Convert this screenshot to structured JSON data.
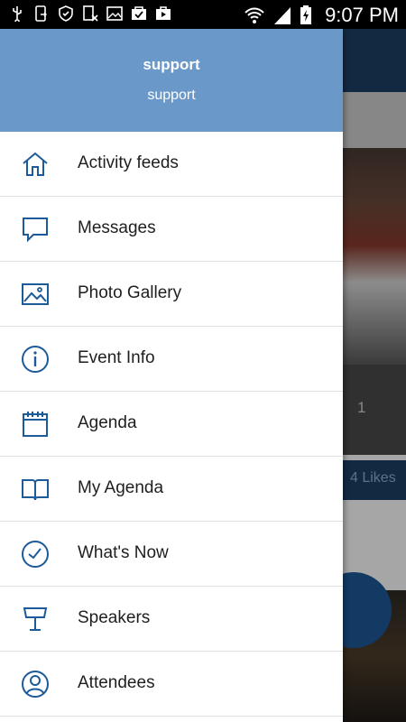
{
  "status_bar": {
    "time": "9:07 PM",
    "left_icons": [
      "usb-icon",
      "device-icon",
      "shield-icon",
      "data-blocked-icon",
      "image-icon",
      "clipboard-check-icon",
      "briefcase-play-icon"
    ],
    "right_icons": [
      "wifi-icon",
      "signal-icon",
      "battery-charging-icon"
    ]
  },
  "drawer": {
    "header": {
      "name": "support",
      "subtitle": "support"
    },
    "items": [
      {
        "label": "Activity feeds",
        "icon": "home-icon"
      },
      {
        "label": "Messages",
        "icon": "chat-icon"
      },
      {
        "label": "Photo Gallery",
        "icon": "image-icon"
      },
      {
        "label": "Event Info",
        "icon": "info-icon"
      },
      {
        "label": "Agenda",
        "icon": "calendar-icon"
      },
      {
        "label": "My Agenda",
        "icon": "book-icon"
      },
      {
        "label": "What's Now",
        "icon": "clock-check-icon"
      },
      {
        "label": "Speakers",
        "icon": "lectern-icon"
      },
      {
        "label": "Attendees",
        "icon": "person-icon"
      }
    ]
  },
  "background": {
    "count": "1",
    "likes": "4 Likes"
  },
  "colors": {
    "header_bg": "#6a99c9",
    "icon_blue": "#1d5a99",
    "bg_dark_blue": "#1d3f66"
  }
}
